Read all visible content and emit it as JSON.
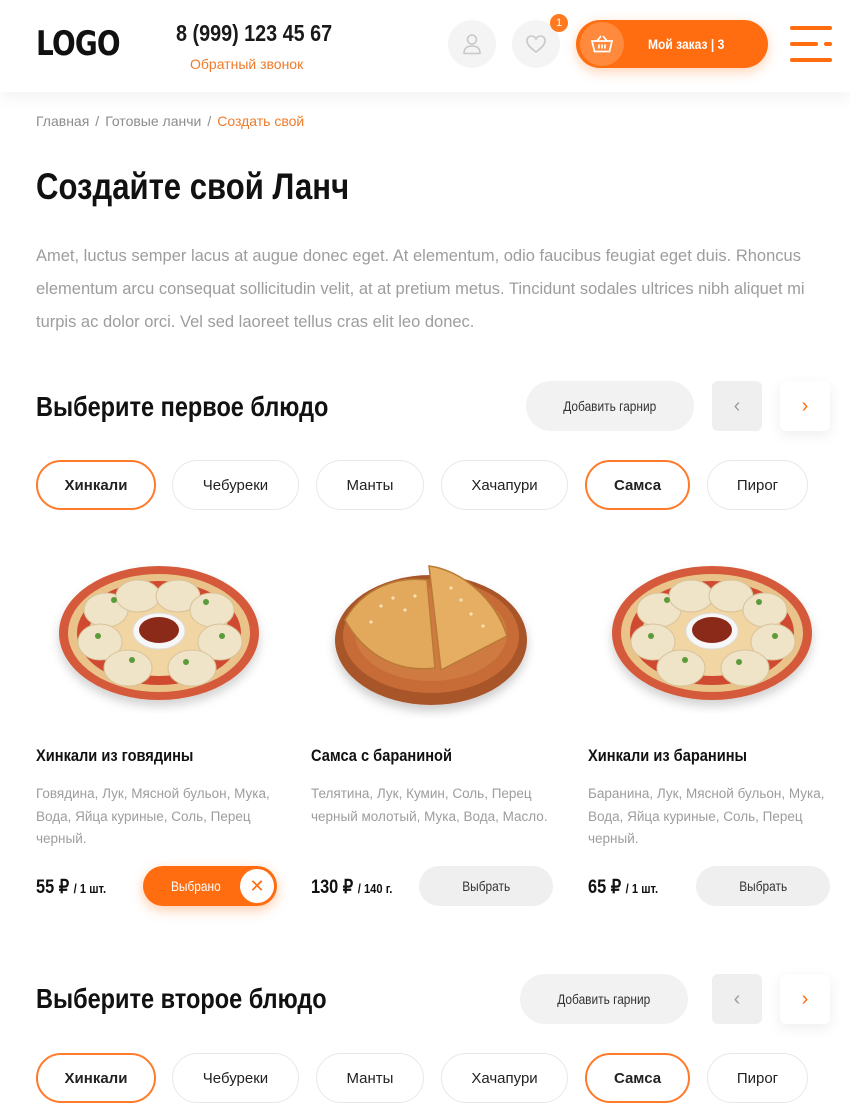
{
  "header": {
    "logo": "LOGO",
    "phone": "8 (999) 123 45 67",
    "callback": "Обратный звонок",
    "favorites_count": "1",
    "order_label": "Мой заказ | 3"
  },
  "breadcrumb": {
    "items": [
      "Главная",
      "Готовые ланчи",
      "Создать свой"
    ],
    "separator": "/"
  },
  "page": {
    "title": "Создайте свой Ланч",
    "intro": "Amet, luctus semper lacus at augue donec eget. At elementum, odio faucibus feugiat eget duis. Rhoncus elementum arcu consequat sollicitudin velit, at at pretium metus. Tincidunt sodales ultrices nibh aliquet mi turpis ac dolor orci. Vel sed laoreet tellus cras elit leo donec."
  },
  "sections": [
    {
      "title": "Выберите первое блюдо",
      "garnish_label": "Добавить гарнир",
      "prev_arrow": "‹",
      "next_arrow": "›",
      "chips": [
        "Хинкали",
        "Чебуреки",
        "Манты",
        "Хачапури",
        "Самса",
        "Пирог"
      ],
      "products": [
        {
          "title": "Хинкали из говядины",
          "description": "Говядина, Лук, Мясной бульон, Мука, Вода, Яйца куриные, Соль, Перец черный.",
          "price": "55 ₽",
          "unit": "/ 1 шт.",
          "button": "Выбрано",
          "selected": true
        },
        {
          "title": "Самса с бараниной",
          "description": "Телятина, Лук, Кумин, Соль, Перец черный молотый, Мука, Вода, Масло.",
          "price": "130 ₽",
          "unit": "/ 140 г.",
          "button": "Выбрать",
          "selected": false
        },
        {
          "title": "Хинкали из баранины",
          "description": "Баранина, Лук, Мясной бульон, Мука, Вода, Яйца куриные, Соль, Перец черный.",
          "price": "65 ₽",
          "unit": "/ 1 шт.",
          "button": "Выбрать",
          "selected": false
        }
      ]
    },
    {
      "title": "Выберите второе блюдо",
      "garnish_label": "Добавить гарнир",
      "prev_arrow": "‹",
      "next_arrow": "›",
      "chips": [
        "Хинкали",
        "Чебуреки",
        "Манты",
        "Хачапури",
        "Самса",
        "Пирог"
      ]
    }
  ],
  "colors": {
    "accent": "#ff6d10",
    "accent_text": "#f07a2a",
    "muted_text": "#9d9d9d",
    "chip_border": "#e8e8e8"
  },
  "icons": [
    "user-icon",
    "heart-icon",
    "basket-icon",
    "burger-menu-icon",
    "close-icon",
    "chevron-left-icon",
    "chevron-right-icon"
  ]
}
